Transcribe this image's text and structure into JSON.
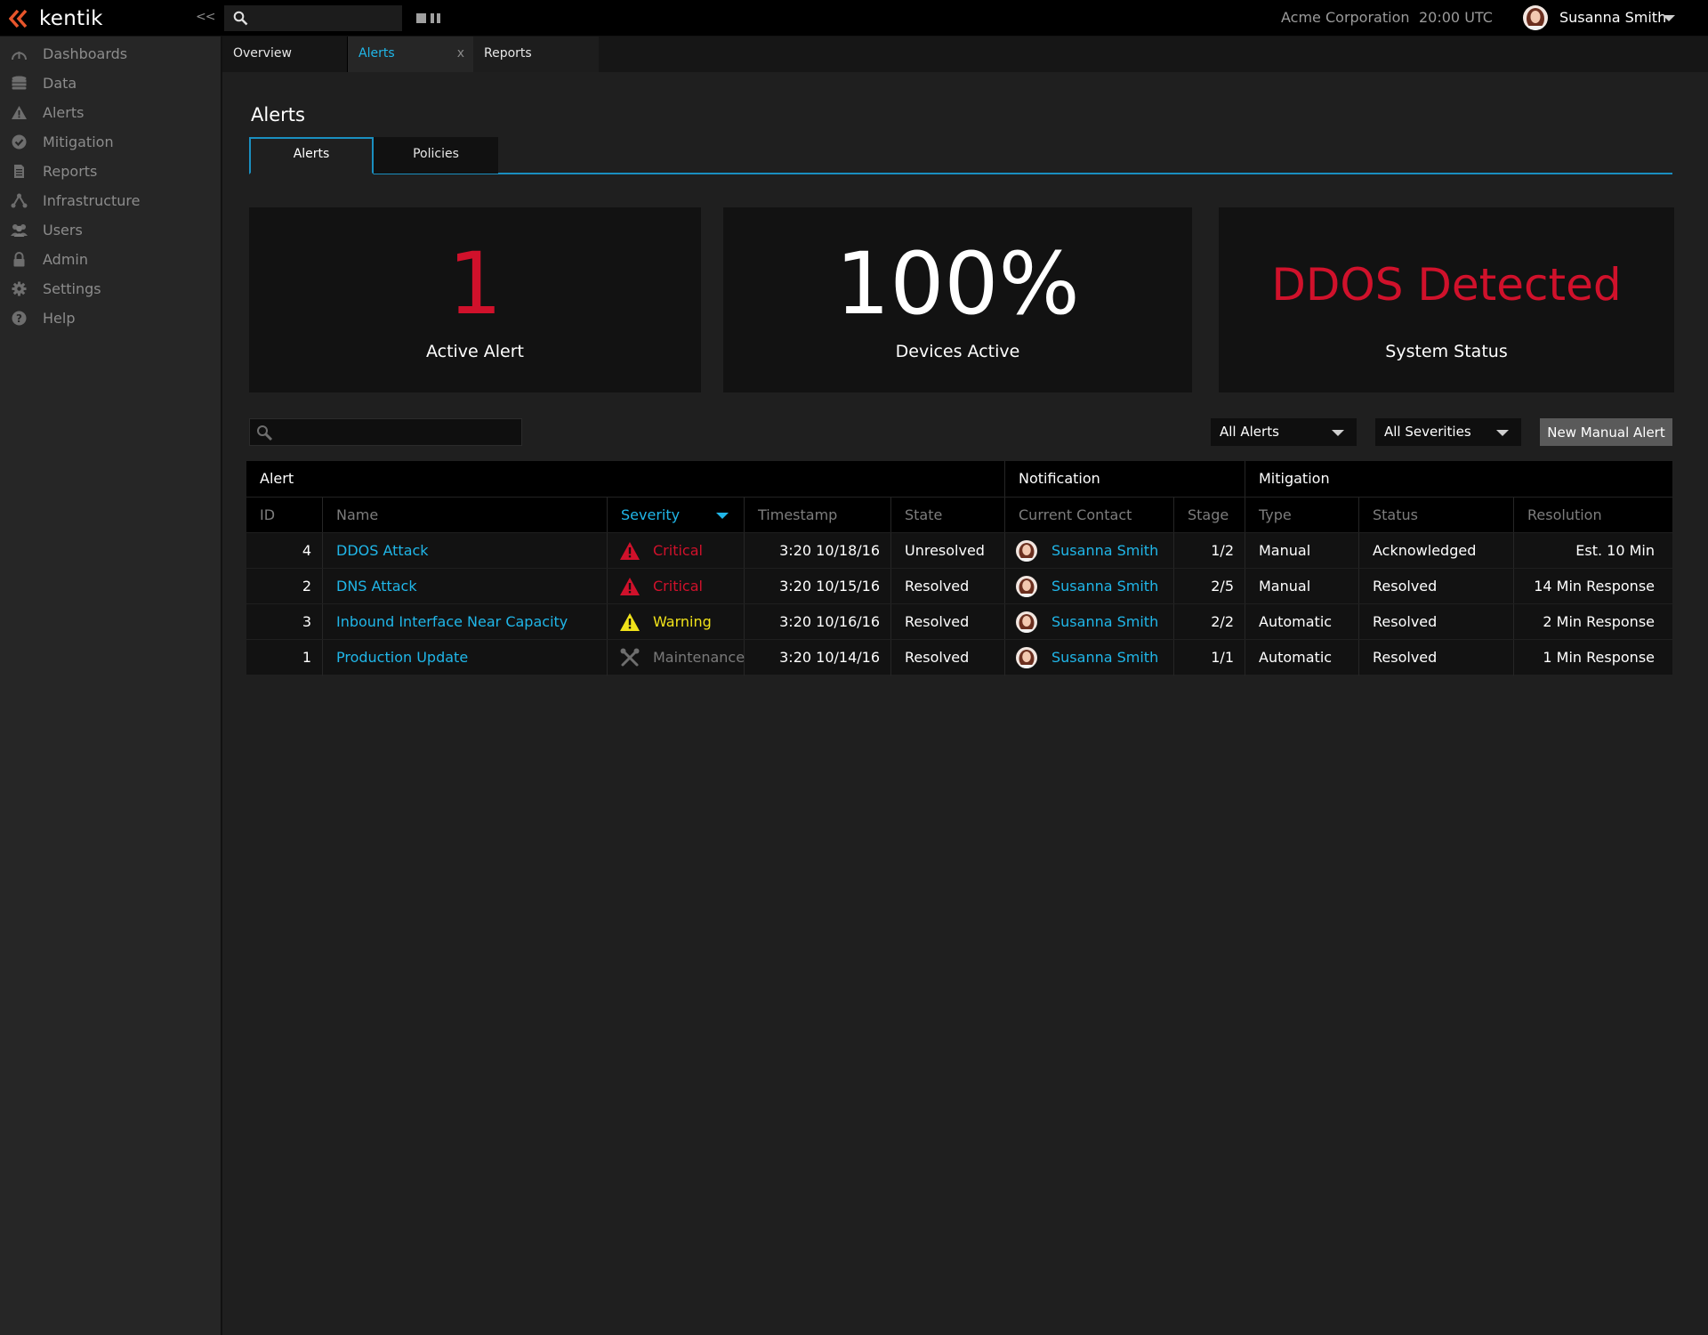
{
  "app": {
    "brand": "kentik",
    "collapse_label": "<<"
  },
  "topbar": {
    "company": "Acme Corporation",
    "time": "20:00 UTC",
    "user_name": "Susanna Smith"
  },
  "sidebar": {
    "items": [
      {
        "label": "Dashboards",
        "icon": "dashboard-icon"
      },
      {
        "label": "Data",
        "icon": "database-icon"
      },
      {
        "label": "Alerts",
        "icon": "alert-triangle-icon"
      },
      {
        "label": "Mitigation",
        "icon": "check-circle-icon"
      },
      {
        "label": "Reports",
        "icon": "report-icon"
      },
      {
        "label": "Infrastructure",
        "icon": "network-icon"
      },
      {
        "label": "Users",
        "icon": "users-icon"
      },
      {
        "label": "Admin",
        "icon": "lock-icon"
      },
      {
        "label": "Settings",
        "icon": "gear-icon"
      },
      {
        "label": "Help",
        "icon": "help-icon"
      }
    ]
  },
  "page_tabs": [
    {
      "label": "Overview"
    },
    {
      "label": "Alerts",
      "close": "x"
    },
    {
      "label": "Reports"
    }
  ],
  "main": {
    "title": "Alerts",
    "subtabs": [
      {
        "label": "Alerts"
      },
      {
        "label": "Policies"
      }
    ],
    "cards": [
      {
        "value": "1",
        "label": "Active Alert",
        "color": "#d0112b"
      },
      {
        "value": "100%",
        "label": "Devices Active",
        "color": "#ffffff"
      },
      {
        "value": "DDOS Detected",
        "label": "System Status",
        "color": "#d0112b"
      }
    ]
  },
  "filters": {
    "search_placeholder": "",
    "alerts_select": "All Alerts",
    "severity_select": "All Severities",
    "new_button": "New Manual Alert"
  },
  "table": {
    "groups": [
      "Alert",
      "Notification",
      "Mitigation"
    ],
    "headers": [
      "ID",
      "Name",
      "Severity",
      "Timestamp",
      "State",
      "Current Contact",
      "Stage",
      "Type",
      "Status",
      "Resolution"
    ],
    "rows": [
      {
        "id": "4",
        "name": "DDOS Attack",
        "severity": "Critical",
        "timestamp": "3:20 10/18/16",
        "state": "Unresolved",
        "contact": "Susanna Smith",
        "stage": "1/2",
        "type": "Manual",
        "status": "Acknowledged",
        "resolution": "Est. 10 Min"
      },
      {
        "id": "2",
        "name": "DNS Attack",
        "severity": "Critical",
        "timestamp": "3:20 10/15/16",
        "state": "Resolved",
        "contact": "Susanna Smith",
        "stage": "2/5",
        "type": "Manual",
        "status": "Resolved",
        "resolution": "14 Min Response"
      },
      {
        "id": "3",
        "name": "Inbound Interface Near Capacity",
        "severity": "Warning",
        "timestamp": "3:20 10/16/16",
        "state": "Resolved",
        "contact": "Susanna Smith",
        "stage": "2/2",
        "type": "Automatic",
        "status": "Resolved",
        "resolution": "2 Min Response"
      },
      {
        "id": "1",
        "name": "Production Update",
        "severity": "Maintenance",
        "timestamp": "3:20 10/14/16",
        "state": "Resolved",
        "contact": "Susanna Smith",
        "stage": "1/1",
        "type": "Automatic",
        "status": "Resolved",
        "resolution": "1 Min Response"
      }
    ]
  },
  "colors": {
    "accent": "#20b6e8",
    "critical": "#d0112b",
    "warning": "#f0e21a",
    "maintenance": "#7a7a7a",
    "brand": "#e8552b"
  }
}
